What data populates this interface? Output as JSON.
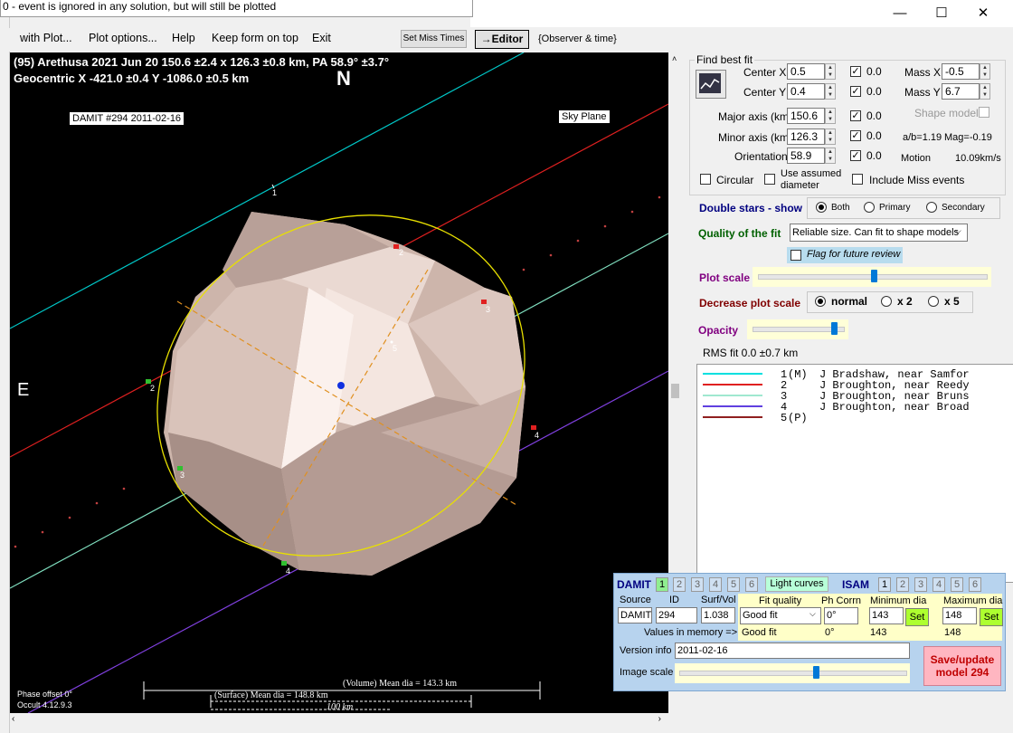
{
  "tooltip": "0 - event is ignored in any solution, but will still be plotted",
  "window_controls": {
    "minimize": "—",
    "maximize": "☐",
    "close": "✕"
  },
  "menu": {
    "with_plot": "with Plot...",
    "plot_options": "Plot options...",
    "help": "Help",
    "keep_on_top": "Keep form on top",
    "exit": "Exit",
    "set_miss_times": "Set Miss Times",
    "editor": "→Editor",
    "observer_time": "{Observer & time}"
  },
  "plot": {
    "title_line1": "(95) Arethusa  2021 Jun 20   150.6 ±2.4 x 126.3 ±0.8 km, PA 58.9° ±3.7°",
    "title_line2": "Geocentric  X  -421.0 ±0.4  Y  -1086.0 ±0.5 km",
    "north": "N",
    "east": "E",
    "damit_label": "DAMIT #294 2011-02-16",
    "sky_plane": "Sky Plane",
    "phase_offset": "Phase offset 0°",
    "occult_version": "Occult 4.12.9.3",
    "volume_mean": "(Volume) Mean dia = 143.3 km",
    "surface_mean": "(Surface) Mean dia = 148.8 km",
    "scale_label": "100 km",
    "chord_labels": [
      "1",
      "2",
      "2",
      "3",
      "3",
      "4",
      "4",
      "5"
    ],
    "colors": {
      "chord1": "#00c8c8",
      "chord2": "#e02020",
      "chord3": "#80e0c0",
      "chord4": "#8040e0",
      "ellipse": "#e8e000",
      "axis": "#e09020",
      "shape": "#e8d2c8"
    }
  },
  "fit": {
    "group_title": "Find best fit",
    "center_x_label": "Center X",
    "center_x": "0.5",
    "center_x_chk": "0.0",
    "center_y_label": "Center Y",
    "center_y": "0.4",
    "center_y_chk": "0.0",
    "mass_x_label": "Mass X",
    "mass_x": "-0.5",
    "mass_y_label": "Mass Y",
    "mass_y": "6.7",
    "major_label": "Major axis (km)",
    "major": "150.6",
    "major_chk": "0.0",
    "minor_label": "Minor axis (km)",
    "minor": "126.3",
    "minor_chk": "0.0",
    "orient_label": "Orientation",
    "orient": "58.9",
    "orient_chk": "0.0",
    "shape_model": "Shape model",
    "ab_ratio": "a/b=1.19",
    "mag": "Mag=-0.19",
    "motion_label": "Motion",
    "motion": "10.09km/s",
    "circular": "Circular",
    "use_assumed_1": "Use assumed",
    "use_assumed_2": "diameter",
    "include_miss": "Include Miss events"
  },
  "double_stars": {
    "label": "Double stars - show",
    "both": "Both",
    "primary": "Primary",
    "secondary": "Secondary"
  },
  "quality": {
    "label": "Quality of the fit",
    "value": "Reliable size. Can fit to shape models",
    "flag": "Flag for future review"
  },
  "plot_scale": {
    "label": "Plot scale",
    "level": 0.5
  },
  "decrease": {
    "label": "Decrease plot scale",
    "normal": "normal",
    "x2": "x 2",
    "x5": "x 5"
  },
  "opacity": {
    "label": "Opacity",
    "level": 0.9
  },
  "rms": "RMS fit 0.0 ±0.7 km",
  "legend": [
    {
      "num": "1",
      "tag": "(M)",
      "name": "J Bradshaw, near Samfor",
      "color": "#00e0e0"
    },
    {
      "num": "2",
      "tag": "",
      "name": "J Broughton, near Reedy",
      "color": "#e02020"
    },
    {
      "num": "3",
      "tag": "",
      "name": "J Broughton, near Bruns",
      "color": "#a0e8d0"
    },
    {
      "num": "4",
      "tag": "",
      "name": "J Broughton, near Broad",
      "color": "#6040e0"
    },
    {
      "num": "5",
      "tag": "(P)",
      "name": "",
      "color": "#902020"
    }
  ],
  "damit": {
    "title": "DAMIT",
    "tabs": [
      "1",
      "2",
      "3",
      "4",
      "5",
      "6"
    ],
    "light_curves": "Light curves",
    "isam": "ISAM",
    "isam_tabs": [
      "1",
      "2",
      "3",
      "4",
      "5",
      "6"
    ],
    "source_label": "Source",
    "id_label": "ID",
    "surfvol_label": "Surf/Vol",
    "source": "DAMIT",
    "id": "294",
    "surfvol": "1.038",
    "fit_quality_label": "Fit quality",
    "ph_corrn_label": "Ph Corrn",
    "min_dia_label": "Minimum dia",
    "max_dia_label": "Maximum dia",
    "fit_quality": "Good fit",
    "ph_corrn": "0°",
    "min_dia": "143",
    "max_dia": "148",
    "set": "Set",
    "values_in_memory": "Values in memory =>",
    "mem_fit": "Good fit",
    "mem_ph": "0°",
    "mem_min": "143",
    "mem_max": "148",
    "version_label": "Version info",
    "version": "2011-02-16",
    "image_scale_label": "Image scale",
    "image_scale_level": 0.6,
    "save_update": "Save/update",
    "save_model": "model 294"
  }
}
